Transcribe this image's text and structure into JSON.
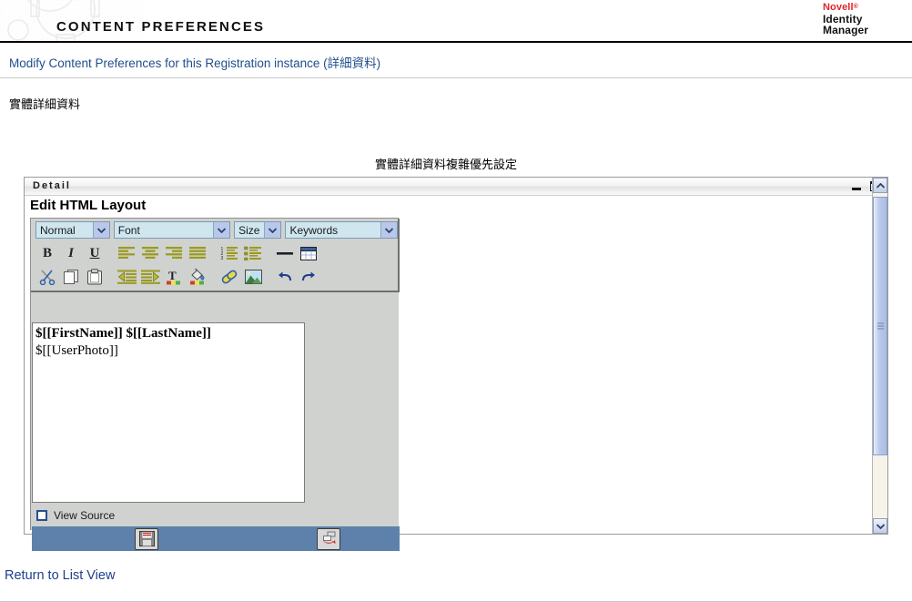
{
  "header": {
    "title": "CONTENT PREFERENCES",
    "brand_name": "Novell",
    "brand_mark": "®",
    "brand_product_line1": "Identity",
    "brand_product_line2": "Manager",
    "gear_icon": "gear-watermark-icon",
    "accent_red": "#e3252a"
  },
  "breadcrumb": {
    "text": "Modify Content Preferences for this Registration instance (詳細資料)",
    "link_color": "#1f4e8c"
  },
  "page": {
    "section_label": "實體詳細資料",
    "section_caption": "實體詳細資料複雜優先設定"
  },
  "detail_panel": {
    "title": "Detail",
    "minimize_icon": "minimize-icon",
    "maximize_icon": "maximize-icon",
    "heading": "Edit HTML Layout"
  },
  "editor": {
    "selects": [
      {
        "name": "paragraph-style",
        "value": "Normal",
        "icon": "chevron-down-icon"
      },
      {
        "name": "font-family",
        "value": "Font",
        "icon": "chevron-down-icon"
      },
      {
        "name": "font-size",
        "value": "Size",
        "icon": "chevron-down-icon"
      },
      {
        "name": "keywords",
        "value": "Keywords",
        "icon": "chevron-down-icon"
      }
    ],
    "toolbar_row1": [
      {
        "name": "bold-button",
        "icon": "bold-icon",
        "glyph": "B"
      },
      {
        "name": "italic-button",
        "icon": "italic-icon",
        "glyph": "I"
      },
      {
        "name": "underline-button",
        "icon": "underline-icon",
        "glyph": "U"
      },
      {
        "name": "align-left-button",
        "icon": "align-left-icon"
      },
      {
        "name": "align-center-button",
        "icon": "align-center-icon"
      },
      {
        "name": "align-right-button",
        "icon": "align-right-icon"
      },
      {
        "name": "align-justify-button",
        "icon": "align-justify-icon"
      },
      {
        "name": "ordered-list-button",
        "icon": "ordered-list-icon"
      },
      {
        "name": "unordered-list-button",
        "icon": "unordered-list-icon"
      },
      {
        "name": "horizontal-rule-button",
        "icon": "horizontal-rule-icon"
      },
      {
        "name": "insert-table-button",
        "icon": "table-icon"
      }
    ],
    "toolbar_row2": [
      {
        "name": "cut-button",
        "icon": "scissors-icon"
      },
      {
        "name": "copy-button",
        "icon": "copy-icon"
      },
      {
        "name": "paste-button",
        "icon": "clipboard-icon"
      },
      {
        "name": "outdent-button",
        "icon": "outdent-icon"
      },
      {
        "name": "indent-button",
        "icon": "indent-icon"
      },
      {
        "name": "text-color-button",
        "icon": "text-color-icon",
        "glyph": "T"
      },
      {
        "name": "background-color-button",
        "icon": "paint-bucket-icon"
      },
      {
        "name": "insert-link-button",
        "icon": "link-chain-icon"
      },
      {
        "name": "insert-image-button",
        "icon": "image-icon"
      },
      {
        "name": "undo-button",
        "icon": "undo-arrow-icon"
      },
      {
        "name": "redo-button",
        "icon": "redo-arrow-icon"
      }
    ],
    "content_lines": [
      {
        "text": "$[[FirstName]] $[[LastName]]",
        "bold": true
      },
      {
        "text": "$[[UserPhoto]]",
        "bold": false
      }
    ],
    "view_source_label": "View Source",
    "view_source_checked": false,
    "actions": [
      {
        "name": "save-button",
        "icon": "floppy-disk-save-icon"
      },
      {
        "name": "cancel-button",
        "icon": "red-return-arrow-icon"
      }
    ],
    "footer_color": "#5d81aa"
  },
  "scrollbar": {
    "up_icon": "chevron-up-icon",
    "down_icon": "chevron-down-icon",
    "grip_icon": "scroll-grip-icon"
  },
  "footer": {
    "return_link": "Return to List View"
  }
}
